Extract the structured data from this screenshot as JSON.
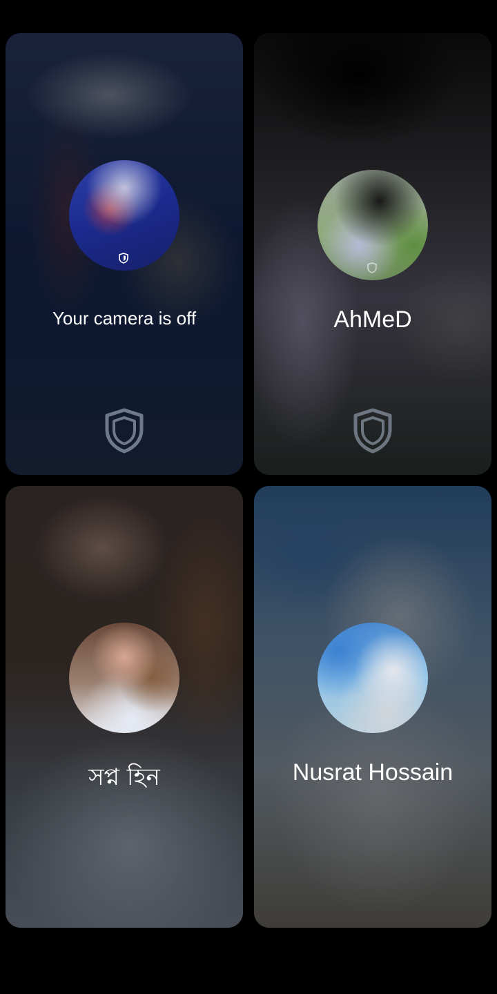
{
  "tiles": [
    {
      "name": "Your camera is off",
      "self": true
    },
    {
      "name": "AhMeD"
    },
    {
      "name": "সপ্ন হিন"
    },
    {
      "name": "Nusrat Hossain"
    }
  ],
  "icons": {
    "shield": "shield-icon",
    "badge": "shield-badge-icon"
  },
  "colors": {
    "background": "#000000",
    "text": "#ffffff",
    "shield": "#8e9aa8"
  }
}
